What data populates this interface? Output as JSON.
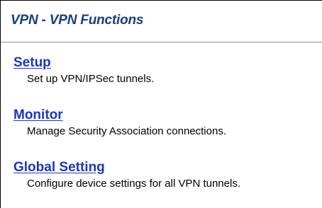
{
  "page": {
    "title": "VPN - VPN Functions"
  },
  "items": [
    {
      "label": "Setup",
      "description": "Set up VPN/IPSec tunnels."
    },
    {
      "label": "Monitor",
      "description": "Manage Security Association connections."
    },
    {
      "label": "Global Setting",
      "description": "Configure device settings for all VPN tunnels."
    }
  ],
  "colors": {
    "title": "#1a3f78",
    "link": "#1e37b4",
    "rule": "#8c8c8c"
  }
}
